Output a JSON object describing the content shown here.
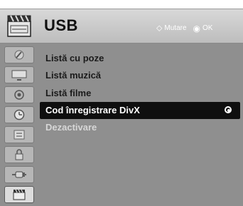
{
  "header": {
    "title": "USB",
    "hint_move_symbol": "⬦",
    "hint_move_label": "Mutare",
    "hint_ok_symbol": "◉",
    "hint_ok_label": "OK"
  },
  "sidebar": {
    "items": [
      {
        "icon": "picture-icon",
        "active": false
      },
      {
        "icon": "monitor-icon",
        "active": false
      },
      {
        "icon": "audio-icon",
        "active": false
      },
      {
        "icon": "clock-icon",
        "active": false
      },
      {
        "icon": "options-icon",
        "active": false
      },
      {
        "icon": "lock-icon",
        "active": false
      },
      {
        "icon": "input-plug-icon",
        "active": false
      },
      {
        "icon": "usb-clapper-icon",
        "active": true
      }
    ]
  },
  "menu": {
    "items": [
      {
        "label": "Listă cu poze",
        "state": "normal"
      },
      {
        "label": "Listă muzică",
        "state": "normal"
      },
      {
        "label": "Listă filme",
        "state": "normal"
      },
      {
        "label": "Cod înregistrare DivX",
        "state": "selected"
      },
      {
        "label": "Dezactivare",
        "state": "disabled"
      }
    ]
  },
  "colors": {
    "panel": "#8f8f8f",
    "header": "#c8c8c8",
    "selected_bg": "#0f0f0f",
    "disabled_text": "#d7d7d7"
  }
}
